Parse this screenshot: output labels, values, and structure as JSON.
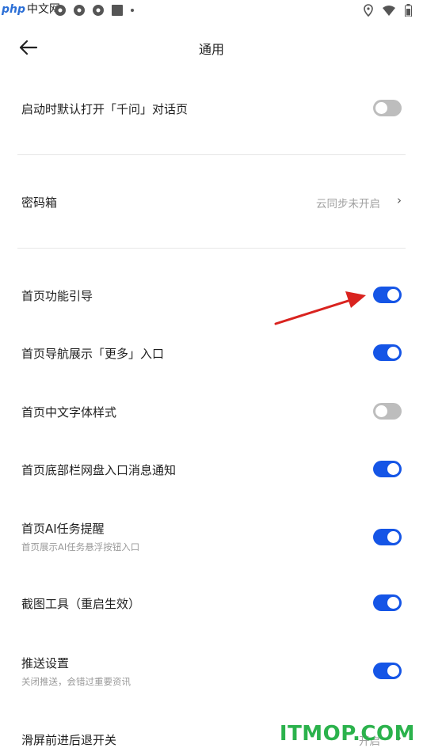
{
  "status_bar": {
    "logo_text": "php",
    "logo_cn": "中文网"
  },
  "header": {
    "title": "通用"
  },
  "settings": [
    {
      "label": "启动时默认打开「千问」对话页",
      "toggle": "off"
    },
    {
      "label": "密码箱",
      "value": "云同步未开启"
    },
    {
      "label": "首页功能引导",
      "toggle": "on"
    },
    {
      "label": "首页导航展示「更多」入口",
      "toggle": "on"
    },
    {
      "label": "首页中文字体样式",
      "toggle": "off"
    },
    {
      "label": "首页底部栏网盘入口消息通知",
      "toggle": "on"
    },
    {
      "label": "首页AI任务提醒",
      "sub": "首页展示AI任务悬浮按钮入口",
      "toggle": "on"
    },
    {
      "label": "截图工具（重启生效）",
      "toggle": "on"
    },
    {
      "label": "推送设置",
      "sub": "关闭推送，会错过重要资讯",
      "toggle": "on"
    },
    {
      "label": "滑屏前进后退开关",
      "value": "开启"
    }
  ],
  "watermark": "ITMOP.COM",
  "colors": {
    "accent": "#1555e6",
    "toggle_off": "#bdbdbd",
    "arrow": "#d9231f",
    "watermark": "#2bb24c"
  }
}
